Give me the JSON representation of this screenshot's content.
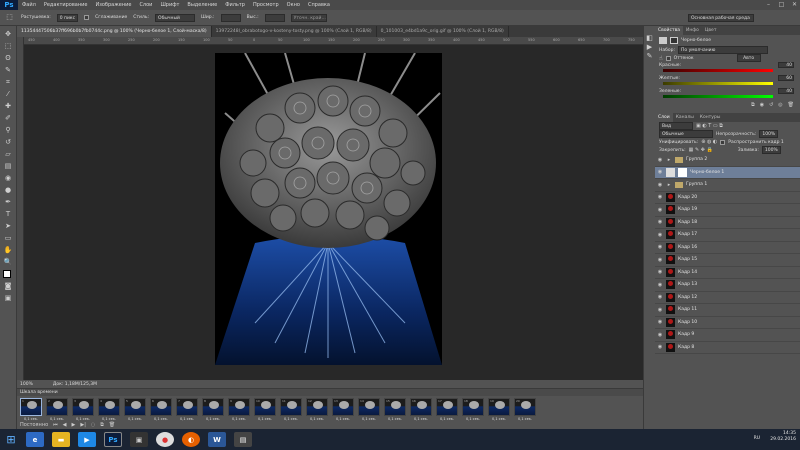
{
  "app": {
    "logo": "Ps"
  },
  "menubar": {
    "items": [
      "Файл",
      "Редактирование",
      "Изображение",
      "Слои",
      "Шрифт",
      "Выделение",
      "Фильтр",
      "Просмотр",
      "Окно",
      "Справка"
    ]
  },
  "optbar": {
    "feather_label": "Растушевка:",
    "feather_value": "0 пикс",
    "antialias_label": "Сглаживание",
    "style_label": "Стиль:",
    "style_value": "Обычный",
    "width_label": "Шир.:",
    "height_label": "Выс.:",
    "refine_label": "Уточн. край...",
    "workspace_value": "Основная рабочая среда"
  },
  "doctabs": [
    {
      "label": "11354447506b37ff696b0b7fb0744c.png @ 100% (Черно-белое 1, Слой-маска/8)",
      "active": true
    },
    {
      "label": "13972248l_obrabotogo-v-kosteny-tosty.png @ 100% (Слой 1, RGB/8)",
      "active": false
    },
    {
      "label": "0_101003_e4bd1a9c_orig.gif @ 100% (Слой 1, RGB/8)",
      "active": false
    }
  ],
  "ruler_marks": [
    "450",
    "400",
    "350",
    "300",
    "250",
    "200",
    "150",
    "100",
    "50",
    "0",
    "50",
    "100",
    "150",
    "200",
    "250",
    "300",
    "350",
    "400",
    "450",
    "500",
    "550",
    "600",
    "650",
    "700",
    "750"
  ],
  "status": {
    "zoom": "100%",
    "doc": "Док: 1,18М/125,3М"
  },
  "timeline": {
    "title": "Шкала времени",
    "frames": [
      {
        "n": "1",
        "d": "0,1 сек."
      },
      {
        "n": "2",
        "d": "0,1 сек."
      },
      {
        "n": "3",
        "d": "0,1 сек."
      },
      {
        "n": "4",
        "d": "0,1 сек."
      },
      {
        "n": "5",
        "d": "0,1 сек."
      },
      {
        "n": "6",
        "d": "0,1 сек."
      },
      {
        "n": "7",
        "d": "0,1 сек."
      },
      {
        "n": "8",
        "d": "0,1 сек."
      },
      {
        "n": "9",
        "d": "0,1 сек."
      },
      {
        "n": "10",
        "d": "0,1 сек."
      },
      {
        "n": "11",
        "d": "0,1 сек."
      },
      {
        "n": "12",
        "d": "0,1 сек."
      },
      {
        "n": "13",
        "d": "0,1 сек."
      },
      {
        "n": "14",
        "d": "0,1 сек."
      },
      {
        "n": "15",
        "d": "0,1 сек."
      },
      {
        "n": "16",
        "d": "0,1 сек."
      },
      {
        "n": "17",
        "d": "0,1 сек."
      },
      {
        "n": "18",
        "d": "0,1 сек."
      },
      {
        "n": "19",
        "d": "0,1 сек."
      },
      {
        "n": "20",
        "d": "0,1 сек."
      }
    ],
    "loop": "Постоянно"
  },
  "properties": {
    "tabs": [
      "Свойства",
      "Инфо",
      "Цвет"
    ],
    "heading": "Черно-белое",
    "preset_label": "Набор:",
    "preset_value": "По умолчанию",
    "tint_label": "Оттенок",
    "auto_label": "Авто",
    "sliders": [
      {
        "name": "Красные:",
        "value": "40",
        "gradient": "linear-gradient(90deg,#3b0000,#ff0000)"
      },
      {
        "name": "Желтые:",
        "value": "60",
        "gradient": "linear-gradient(90deg,#3b3b00,#ffff00)"
      },
      {
        "name": "Зеленые:",
        "value": "40",
        "gradient": "linear-gradient(90deg,#003b00,#00ff00)"
      }
    ]
  },
  "layers": {
    "tabs": [
      "Слои",
      "Каналы",
      "Контуры"
    ],
    "kind_label": "Вид",
    "blend_value": "Обычные",
    "opacity_label": "Непрозрачность:",
    "opacity_value": "100%",
    "unify_label": "Унифицировать:",
    "propagate_label": "Распространить кадр 1",
    "lock_label": "Закрепить:",
    "fill_label": "Заливка:",
    "fill_value": "100%",
    "items": [
      {
        "name": "Группа 2",
        "kind": "folder",
        "selected": false
      },
      {
        "name": "Черно-белое 1",
        "kind": "adjust",
        "selected": true
      },
      {
        "name": "Группа 1",
        "kind": "folder",
        "selected": false
      },
      {
        "name": "Кадр 20",
        "kind": "rose",
        "selected": false
      },
      {
        "name": "Кадр 19",
        "kind": "rose",
        "selected": false
      },
      {
        "name": "Кадр 18",
        "kind": "rose",
        "selected": false
      },
      {
        "name": "Кадр 17",
        "kind": "rose",
        "selected": false
      },
      {
        "name": "Кадр 16",
        "kind": "rose",
        "selected": false
      },
      {
        "name": "Кадр 15",
        "kind": "rose",
        "selected": false
      },
      {
        "name": "Кадр 14",
        "kind": "rose",
        "selected": false
      },
      {
        "name": "Кадр 13",
        "kind": "rose",
        "selected": false
      },
      {
        "name": "Кадр 12",
        "kind": "rose",
        "selected": false
      },
      {
        "name": "Кадр 11",
        "kind": "rose",
        "selected": false
      },
      {
        "name": "Кадр 10",
        "kind": "rose",
        "selected": false
      },
      {
        "name": "Кадр 9",
        "kind": "rose",
        "selected": false
      },
      {
        "name": "Кадр 8",
        "kind": "rose",
        "selected": false
      }
    ]
  },
  "taskbar": {
    "time": "14:35",
    "date": "29.02.2016",
    "lang": "RU"
  }
}
